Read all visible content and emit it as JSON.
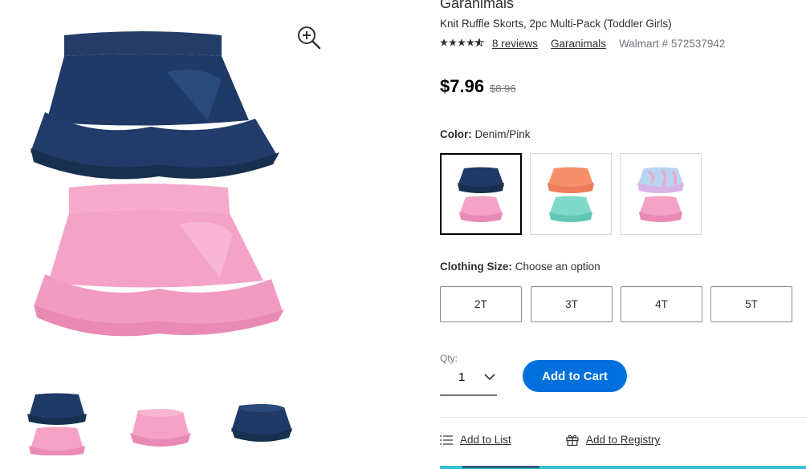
{
  "product": {
    "brand": "Garanimals",
    "title": "Knit Ruffle Skorts, 2pc Multi-Pack (Toddler Girls)",
    "rating_stars": "★★★★★",
    "rating_value": 4.5,
    "reviews_link": "8 reviews",
    "brand_link": "Garanimals",
    "item_number": "Walmart # 572537942",
    "price": "$7.96",
    "was_price": "$8.96"
  },
  "gallery": {
    "zoom_icon": "zoom-in-icon",
    "thumbnails": [
      "denim-pink-pair",
      "pink-skort",
      "denim-skort"
    ]
  },
  "color": {
    "label": "Color:",
    "selected": "Denim/Pink",
    "swatches": [
      "Denim/Pink",
      "Coral/Mint",
      "Tie-dye/Pink"
    ]
  },
  "size": {
    "label": "Clothing Size:",
    "prompt": "Choose an option",
    "options": [
      "2T",
      "3T",
      "4T",
      "5T"
    ]
  },
  "qty": {
    "label": "Qty:",
    "value": "1"
  },
  "actions": {
    "add_to_cart": "Add to Cart",
    "add_to_list": "Add to List",
    "add_to_registry": "Add to Registry"
  },
  "colors": {
    "primary_blue": "#0071dc",
    "denim": "#1f3a66",
    "pink": "#f4a7c9",
    "coral": "#f7906a",
    "mint": "#7fd8c8"
  }
}
